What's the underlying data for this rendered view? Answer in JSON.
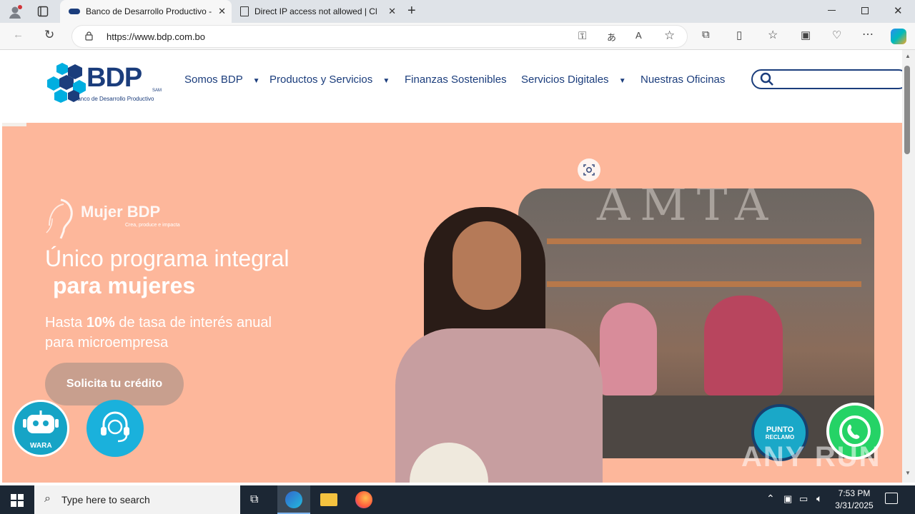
{
  "browser": {
    "tabs": [
      {
        "title": "Banco de Desarrollo Productivo - ",
        "favicon": "bdp-favicon",
        "active": true
      },
      {
        "title": "Direct IP access not allowed | Clo",
        "favicon": "page-icon",
        "active": false
      }
    ],
    "url": "https://www.bdp.com.bo"
  },
  "site": {
    "logo_text": "BDP",
    "logo_tag": "SAM",
    "logo_sub": "Banco de Desarrollo Productivo",
    "nav": [
      {
        "label": "Somos BDP",
        "dropdown": true
      },
      {
        "label": "Productos y Servicios",
        "dropdown": true
      },
      {
        "label": "Finanzas Sostenibles",
        "dropdown": false
      },
      {
        "label": "Servicios Digitales",
        "dropdown": true
      },
      {
        "label": "Nuestras Oficinas",
        "dropdown": false
      }
    ],
    "search_placeholder": ""
  },
  "hero": {
    "brand": "Mujer BDP",
    "brand_tagline": "Crea, produce e impacta",
    "title_line1": "Único programa integral",
    "title_line2": "para mujeres",
    "sub_line1_pre": "Hasta ",
    "sub_line1_bold": "10%",
    "sub_line1_post": " de tasa de interés anual",
    "sub_line2": "para microempresa",
    "cta": "Solicita tu crédito",
    "mural_text": "AMTA",
    "background_color": "#fdb79b"
  },
  "floating": {
    "wara_label": "WARA",
    "punto_label_1": "PUNTO",
    "punto_label_2": "RECLAMO"
  },
  "watermark": "ANY RUN",
  "taskbar": {
    "search_placeholder": "Type here to search",
    "time": "7:53 PM",
    "date": "3/31/2025"
  }
}
